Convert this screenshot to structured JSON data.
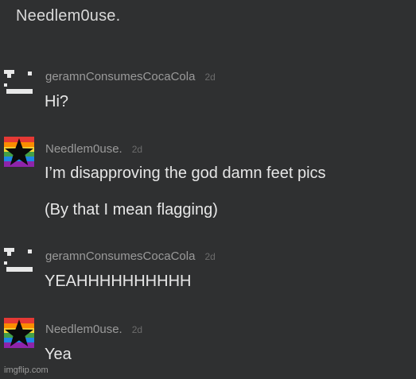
{
  "header": {
    "title": "Needlem0use."
  },
  "messages": [
    {
      "author": "geramnConsumesCocaCola",
      "time": "2d",
      "avatar_icon": "pixel-face-icon",
      "lines": [
        "Hi?"
      ]
    },
    {
      "author": "Needlem0use.",
      "time": "2d",
      "avatar_icon": "rainbow-star-icon",
      "lines": [
        "I’m disapproving the god damn feet pics",
        "(By that I mean flagging)"
      ]
    },
    {
      "author": "geramnConsumesCocaCola",
      "time": "2d",
      "avatar_icon": "pixel-face-icon",
      "lines": [
        "YEAHHHHHHHHHH"
      ]
    },
    {
      "author": "Needlem0use.",
      "time": "2d",
      "avatar_icon": "rainbow-star-icon",
      "lines": [
        "Yea"
      ]
    }
  ],
  "watermark": "imgflip.com",
  "colors": {
    "background": "#2f3031",
    "message_text": "#e6e6e6",
    "author_text": "#9a9a9a",
    "timestamp_text": "#6c6c6c"
  }
}
